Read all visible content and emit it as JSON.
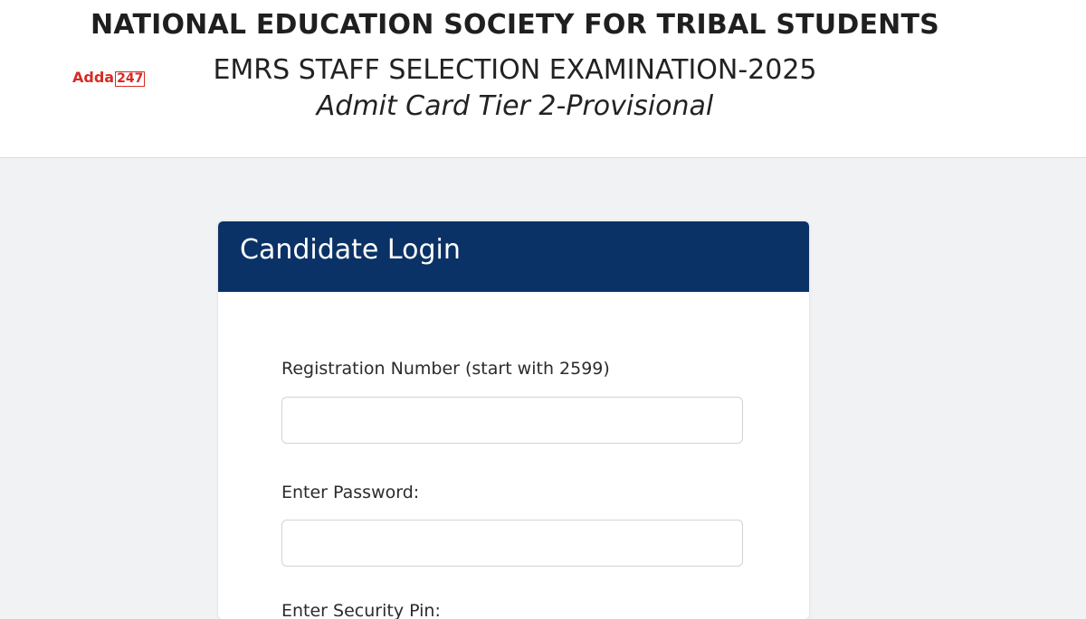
{
  "header": {
    "org_title": "NATIONAL EDUCATION SOCIETY FOR TRIBAL STUDENTS",
    "exam_title": "EMRS STAFF SELECTION EXAMINATION-2025",
    "sub_title": "Admit Card Tier 2-Provisional"
  },
  "watermark": {
    "text_a": "Adda",
    "text_b": "247"
  },
  "login_card": {
    "title": "Candidate Login",
    "header_color": "#0b3266",
    "registration": {
      "label": "Registration Number (start with 2599)",
      "value": "",
      "placeholder": ""
    },
    "password": {
      "label": "Enter Password:",
      "value": "",
      "placeholder": ""
    },
    "next_field_label": "Enter Security Pin:"
  }
}
